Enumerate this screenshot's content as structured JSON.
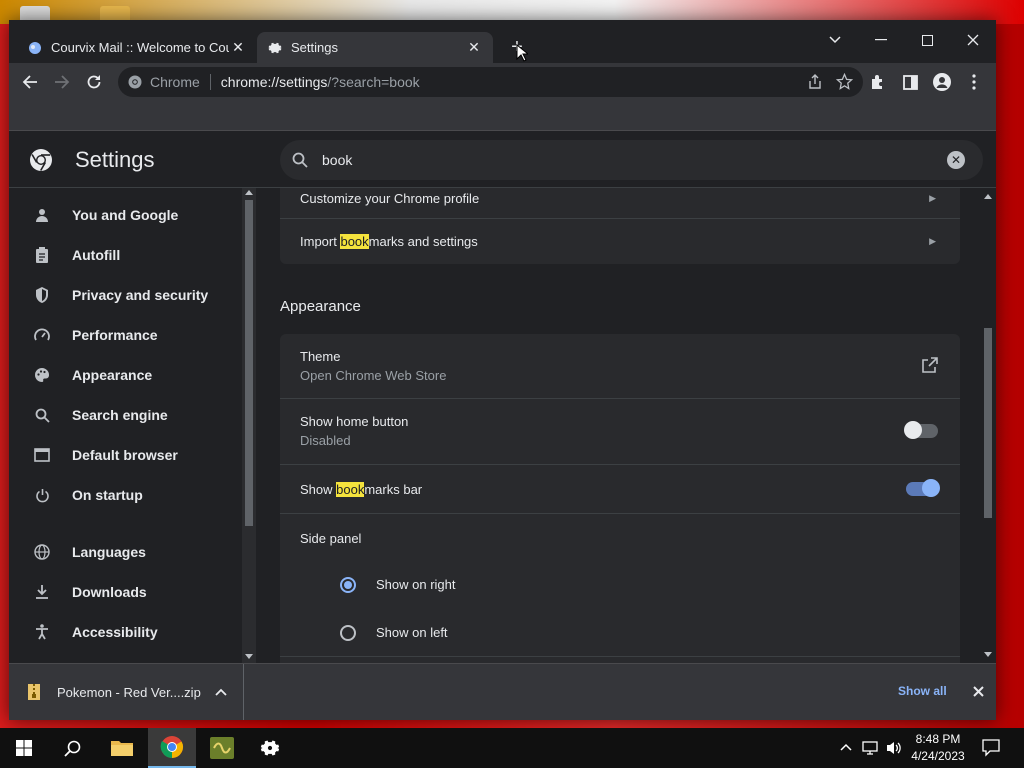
{
  "browser": {
    "tabs": [
      {
        "title": "Courvix Mail :: Welcome to Courvix",
        "active": false
      },
      {
        "title": "Settings",
        "active": true
      }
    ],
    "omnibox": {
      "chip": "Chrome",
      "url_host": "chrome://settings",
      "url_rest": "/?search=book"
    }
  },
  "settings": {
    "title": "Settings",
    "search_query": "book",
    "nav": [
      {
        "label": "You and Google",
        "icon": "person-icon"
      },
      {
        "label": "Autofill",
        "icon": "clipboard-icon"
      },
      {
        "label": "Privacy and security",
        "icon": "shield-icon"
      },
      {
        "label": "Performance",
        "icon": "gauge-icon"
      },
      {
        "label": "Appearance",
        "icon": "palette-icon"
      },
      {
        "label": "Search engine",
        "icon": "search-icon"
      },
      {
        "label": "Default browser",
        "icon": "browser-icon"
      },
      {
        "label": "On startup",
        "icon": "power-icon"
      },
      {
        "label": "Languages",
        "icon": "globe-icon"
      },
      {
        "label": "Downloads",
        "icon": "download-icon"
      },
      {
        "label": "Accessibility",
        "icon": "accessibility-icon"
      }
    ],
    "people_rows": {
      "customize": "Customize your Chrome profile",
      "import_pre": "Import ",
      "import_hl": "book",
      "import_post": "marks and settings"
    },
    "appearance": {
      "heading": "Appearance",
      "theme_label": "Theme",
      "theme_sub": "Open Chrome Web Store",
      "home_label": "Show home button",
      "home_sub": "Disabled",
      "home_enabled": false,
      "bm_pre": "Show ",
      "bm_hl": "book",
      "bm_post": "marks bar",
      "bm_enabled": true,
      "side_panel_label": "Side panel",
      "side_right": "Show on right",
      "side_left": "Show on left",
      "side_selected": "right"
    }
  },
  "downloads": {
    "file": "Pokemon - Red Ver....zip",
    "show_all": "Show all"
  },
  "taskbar": {
    "time": "8:48 PM",
    "date": "4/24/2023"
  },
  "colors": {
    "accent": "#8ab4f8",
    "highlight": "#f5e33d",
    "background": "#202124"
  }
}
